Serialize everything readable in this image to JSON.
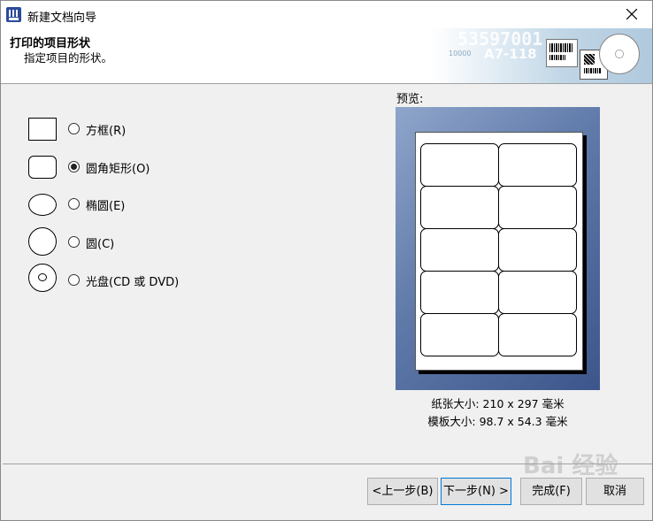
{
  "window": {
    "title": "新建文档向导"
  },
  "header": {
    "title": "打印的项目形状",
    "subtitle": "指定项目的形状。"
  },
  "banner": {
    "number_text": "53597001",
    "tag_text": "A7-118",
    "small_text": "10000"
  },
  "options": [
    {
      "label": "方框(R)",
      "selected": false,
      "shape": "rectangle"
    },
    {
      "label": "圆角矩形(O)",
      "selected": true,
      "shape": "rounded-rectangle"
    },
    {
      "label": "椭圆(E)",
      "selected": false,
      "shape": "ellipse"
    },
    {
      "label": "圆(C)",
      "selected": false,
      "shape": "circle"
    },
    {
      "label": "光盘(CD 或 DVD)",
      "selected": false,
      "shape": "disc"
    }
  ],
  "preview": {
    "label": "预览:",
    "paper_size": "纸张大小: 210 x 297 毫米",
    "template_size": "模板大小: 98.7 x 54.3 毫米",
    "columns": 2,
    "rows": 5,
    "background": "#5f79a9"
  },
  "buttons": {
    "back": "<上一步(B)",
    "next": "下一步(N) >",
    "finish": "完成(F)",
    "cancel": "取消"
  },
  "watermark": {
    "text": "Bai 经验"
  },
  "colors": {
    "accent": "#0078d7"
  }
}
